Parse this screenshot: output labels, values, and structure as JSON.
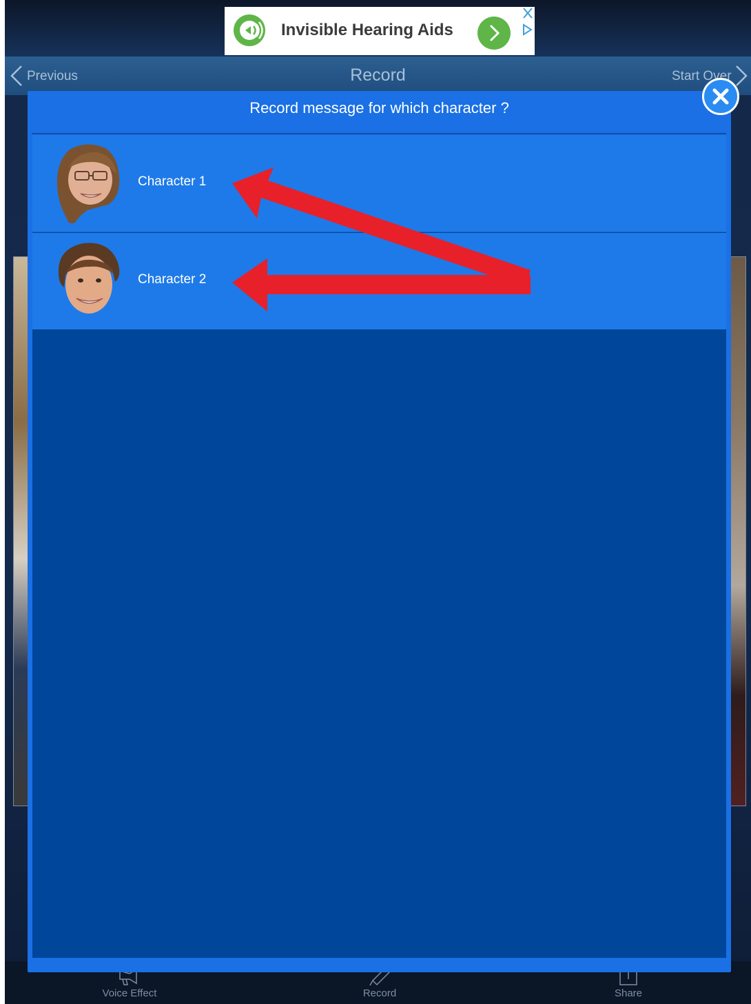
{
  "ad": {
    "title": "Invisible Hearing Aids",
    "icon": "speaker-icon",
    "accent": "#5fb548"
  },
  "nav": {
    "previous_label": "Previous",
    "title": "Record",
    "start_over_label": "Start Over"
  },
  "dialog": {
    "title": "Record message for which character ?",
    "characters": [
      {
        "label": "Character 1"
      },
      {
        "label": "Character 2"
      }
    ],
    "background": "#1a70e4",
    "row_color": "#1e7ae8",
    "body_color": "#00469a"
  },
  "toolbar": {
    "items": [
      {
        "label": "Voice Effect",
        "icon": "megaphone-icon"
      },
      {
        "label": "Record",
        "icon": "microphone-icon"
      },
      {
        "label": "Share",
        "icon": "share-icon"
      }
    ]
  },
  "annotation": {
    "arrow_color": "#e8202a"
  }
}
